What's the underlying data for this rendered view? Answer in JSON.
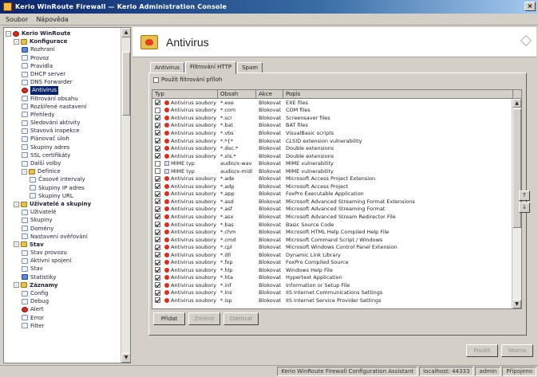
{
  "window": {
    "title": "Kerio WinRoute Firewall — Kerio Administration Console",
    "close_glyph": "×"
  },
  "menu": [
    "Soubor",
    "Nápověda"
  ],
  "tree": {
    "items": [
      {
        "label": "Kerio WinRoute",
        "level": 0,
        "icon": "red",
        "bold": true,
        "expander": "-"
      },
      {
        "label": "Konfigurace",
        "level": 1,
        "icon": "folder",
        "bold": true,
        "expander": "-"
      },
      {
        "label": "Rozhraní",
        "level": 2,
        "icon": "net"
      },
      {
        "label": "Provoz",
        "level": 2,
        "icon": "page"
      },
      {
        "label": "Pravidla",
        "level": 2,
        "icon": "page"
      },
      {
        "label": "DHCP server",
        "level": 2,
        "icon": "page"
      },
      {
        "label": "DNS Forwarder",
        "level": 2,
        "icon": "page"
      },
      {
        "label": "Antivirus",
        "level": 2,
        "icon": "red",
        "selected": true
      },
      {
        "label": "Filtrování obsahu",
        "level": 2,
        "icon": "page"
      },
      {
        "label": "Rozšířené nastavení",
        "level": 2,
        "icon": "page"
      },
      {
        "label": "Přehledy",
        "level": 2,
        "icon": "page"
      },
      {
        "label": "Sledování aktivity",
        "level": 2,
        "icon": "page"
      },
      {
        "label": "Stavová inspekce",
        "level": 2,
        "icon": "page"
      },
      {
        "label": "Plánovač úloh",
        "level": 2,
        "icon": "page"
      },
      {
        "label": "Skupiny adres",
        "level": 2,
        "icon": "page"
      },
      {
        "label": "SSL certifikáty",
        "level": 2,
        "icon": "page"
      },
      {
        "label": "Další volby",
        "level": 2,
        "icon": "page"
      },
      {
        "label": "Definice",
        "level": 2,
        "icon": "folder",
        "expander": "-"
      },
      {
        "label": "Časové intervaly",
        "level": 3,
        "icon": "page"
      },
      {
        "label": "Skupiny IP adres",
        "level": 3,
        "icon": "page"
      },
      {
        "label": "Skupiny URL",
        "level": 3,
        "icon": "page"
      },
      {
        "label": "Uživatelé a skupiny",
        "level": 1,
        "icon": "folder",
        "bold": true,
        "expander": "-"
      },
      {
        "label": "Uživatelé",
        "level": 2,
        "icon": "page"
      },
      {
        "label": "Skupiny",
        "level": 2,
        "icon": "page"
      },
      {
        "label": "Domény",
        "level": 2,
        "icon": "page"
      },
      {
        "label": "Nastavení ověřování",
        "level": 2,
        "icon": "page"
      },
      {
        "label": "Stav",
        "level": 1,
        "icon": "folder",
        "bold": true,
        "expander": "-"
      },
      {
        "label": "Stav provozu",
        "level": 2,
        "icon": "page"
      },
      {
        "label": "Aktivní spojení",
        "level": 2,
        "icon": "page"
      },
      {
        "label": "Stav",
        "level": 2,
        "icon": "page"
      },
      {
        "label": "Statistiky",
        "level": 2,
        "icon": "net"
      },
      {
        "label": "Záznamy",
        "level": 1,
        "icon": "folder",
        "bold": true,
        "expander": "-"
      },
      {
        "label": "Config",
        "level": 2,
        "icon": "page"
      },
      {
        "label": "Debug",
        "level": 2,
        "icon": "page"
      },
      {
        "label": "Alert",
        "level": 2,
        "icon": "red"
      },
      {
        "label": "Error",
        "level": 2,
        "icon": "page"
      },
      {
        "label": "Filter",
        "level": 2,
        "icon": "page"
      }
    ]
  },
  "header": {
    "title": "Antivirus"
  },
  "tabs": [
    "Antivirus",
    "Filtrování HTTP",
    "Spam"
  ],
  "filter": {
    "label": "Použít filtrování příloh"
  },
  "grid": {
    "columns": [
      "Typ",
      "Obsah",
      "Akce",
      "Popis"
    ],
    "rows": [
      {
        "checked": true,
        "icon": "red",
        "type": "Antivirus soubory",
        "content": "*.exe",
        "action": "Blokovat",
        "desc": "EXE files"
      },
      {
        "checked": false,
        "icon": "red",
        "type": "Antivirus soubory",
        "content": "*.com",
        "action": "Blokovat",
        "desc": "COM files"
      },
      {
        "checked": true,
        "icon": "red",
        "type": "Antivirus soubory",
        "content": "*.scr",
        "action": "Blokovat",
        "desc": "Screensaver files"
      },
      {
        "checked": true,
        "icon": "red",
        "type": "Antivirus soubory",
        "content": "*.bat",
        "action": "Blokovat",
        "desc": "BAT files"
      },
      {
        "checked": true,
        "icon": "red",
        "type": "Antivirus soubory",
        "content": "*.vbs",
        "action": "Blokovat",
        "desc": "VisualBasic scripts"
      },
      {
        "checked": true,
        "icon": "red",
        "type": "Antivirus soubory",
        "content": "*.*{*",
        "action": "Blokovat",
        "desc": "CLSID extension vulnerability"
      },
      {
        "checked": true,
        "icon": "red",
        "type": "Antivirus soubory",
        "content": "*.doc.*",
        "action": "Blokovat",
        "desc": "Double extensions"
      },
      {
        "checked": true,
        "icon": "red",
        "type": "Antivirus soubory",
        "content": "*.xls.*",
        "action": "Blokovat",
        "desc": "Double extensions"
      },
      {
        "checked": false,
        "icon": "doc",
        "type": "MIME typ",
        "content": "audio/x-wav",
        "action": "Blokovat",
        "desc": "MIME vulnerability"
      },
      {
        "checked": false,
        "icon": "doc",
        "type": "MIME typ",
        "content": "audio/x-midi",
        "action": "Blokovat",
        "desc": "MIME vulnerability"
      },
      {
        "checked": true,
        "icon": "red",
        "type": "Antivirus soubory",
        "content": "*.ade",
        "action": "Blokovat",
        "desc": "Microsoft Access Project Extension"
      },
      {
        "checked": true,
        "icon": "red",
        "type": "Antivirus soubory",
        "content": "*.adp",
        "action": "Blokovat",
        "desc": "Microsoft Access Project"
      },
      {
        "checked": true,
        "icon": "red",
        "type": "Antivirus soubory",
        "content": "*.app",
        "action": "Blokovat",
        "desc": "FoxPro Executable Application"
      },
      {
        "checked": true,
        "icon": "red",
        "type": "Antivirus soubory",
        "content": "*.asd",
        "action": "Blokovat",
        "desc": "Microsoft Advanced Streaming Format Extensions"
      },
      {
        "checked": true,
        "icon": "red",
        "type": "Antivirus soubory",
        "content": "*.asf",
        "action": "Blokovat",
        "desc": "Microsoft Advanced Streaming Format"
      },
      {
        "checked": true,
        "icon": "red",
        "type": "Antivirus soubory",
        "content": "*.asx",
        "action": "Blokovat",
        "desc": "Microsoft Advanced Stream Redirector File"
      },
      {
        "checked": true,
        "icon": "red",
        "type": "Antivirus soubory",
        "content": "*.bas",
        "action": "Blokovat",
        "desc": "Basic Source Code"
      },
      {
        "checked": true,
        "icon": "red",
        "type": "Antivirus soubory",
        "content": "*.chm",
        "action": "Blokovat",
        "desc": "Microsoft HTML Help Compiled Help File"
      },
      {
        "checked": true,
        "icon": "red",
        "type": "Antivirus soubory",
        "content": "*.cmd",
        "action": "Blokovat",
        "desc": "Microsoft Command Script / Windows"
      },
      {
        "checked": true,
        "icon": "red",
        "type": "Antivirus soubory",
        "content": "*.cpl",
        "action": "Blokovat",
        "desc": "Microsoft Windows Control Panel Extension"
      },
      {
        "checked": true,
        "icon": "red",
        "type": "Antivirus soubory",
        "content": "*.dll",
        "action": "Blokovat",
        "desc": "Dynamic Link Library"
      },
      {
        "checked": true,
        "icon": "red",
        "type": "Antivirus soubory",
        "content": "*.fxp",
        "action": "Blokovat",
        "desc": "FoxPro Compiled Source"
      },
      {
        "checked": true,
        "icon": "red",
        "type": "Antivirus soubory",
        "content": "*.hlp",
        "action": "Blokovat",
        "desc": "Windows Help File"
      },
      {
        "checked": true,
        "icon": "red",
        "type": "Antivirus soubory",
        "content": "*.hta",
        "action": "Blokovat",
        "desc": "Hypertext Application"
      },
      {
        "checked": true,
        "icon": "red",
        "type": "Antivirus soubory",
        "content": "*.inf",
        "action": "Blokovat",
        "desc": "Information or Setup File"
      },
      {
        "checked": true,
        "icon": "red",
        "type": "Antivirus soubory",
        "content": "*.ins",
        "action": "Blokovat",
        "desc": "IIS Internet Communications Settings"
      },
      {
        "checked": true,
        "icon": "red",
        "type": "Antivirus soubory",
        "content": "*.isp",
        "action": "Blokovat",
        "desc": "IIS Internet Service Provider Settings"
      }
    ]
  },
  "buttons": {
    "add": "Přidat",
    "edit": "Změnit",
    "remove": "Odebrat",
    "apply": "Použít",
    "cancel": "Storno",
    "up": "↑",
    "down": "↓"
  },
  "status": [
    "Kerio WinRoute Firewall Configuration Assistant",
    "localhost: 44333",
    "admin",
    "Připojeno"
  ]
}
